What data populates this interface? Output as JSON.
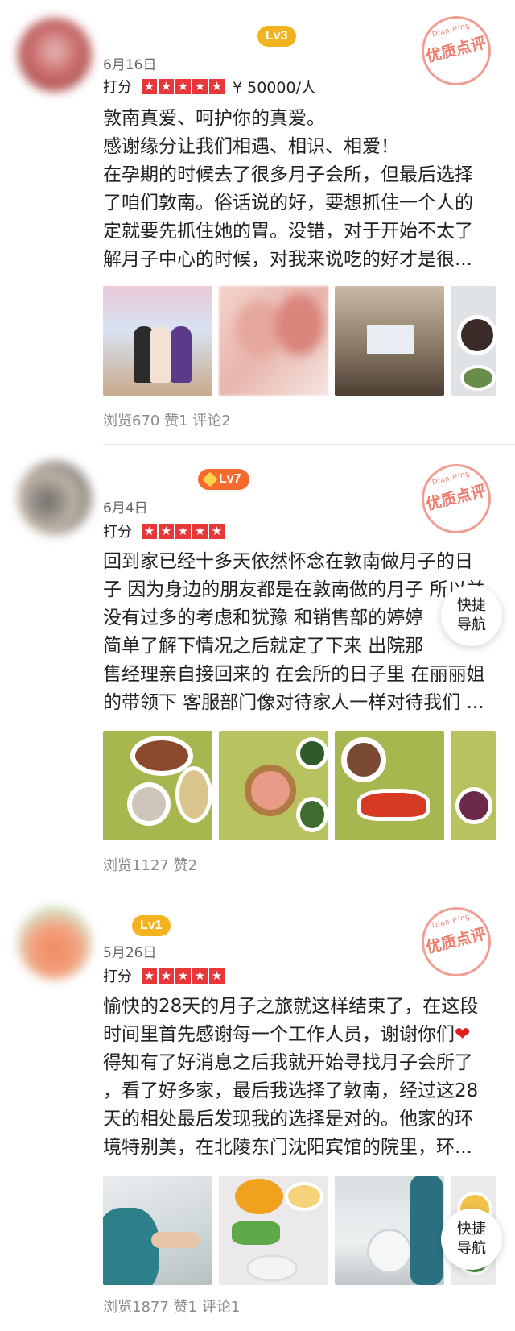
{
  "reviews": [
    {
      "level": "Lv3",
      "date": "6月16日",
      "score_label": "打分",
      "price": "¥ 50000/人",
      "stamp_en": "Dian Ping",
      "stamp_cn": "优质点评",
      "lines": [
        "敦南真爱、呵护你的真爱。",
        "感谢缘分让我们相遇、相识、相爱！",
        "在孕期的时候去了很多月子会所，但最后选择",
        "了咱们敦南。俗话说的好，要想抓住一个人的",
        "定就要先抓住她的胃。没错，对于开始不太了",
        "解月子中心的时候，对我来说吃的好才是很..."
      ],
      "stats": "浏览670  赞1  评论2",
      "rating": 5
    },
    {
      "level": "Lv7",
      "date": "6月4日",
      "score_label": "打分",
      "price": "",
      "stamp_en": "Dian Ping",
      "stamp_cn": "优质点评",
      "lines": [
        "回到家已经十多天依然怀念在敦南做月子的日",
        "子 因为身边的朋友都是在敦南做的月子 所以并",
        "没有过多的考虑和犹豫 和销售部的婷婷",
        "简单了解下情况之后就定了下来 出院那",
        "售经理亲自接回来的 在会所的日子里 在丽丽姐",
        "的带领下 客服部门像对待家人一样对待我们 ..."
      ],
      "stats": "浏览1127  赞2",
      "rating": 5
    },
    {
      "level": "Lv1",
      "date": "5月26日",
      "score_label": "打分",
      "price": "",
      "stamp_en": "Dian Ping",
      "stamp_cn": "优质点评",
      "lines": [
        "愉快的28天的月子之旅就这样结束了，在这段",
        "时间里首先感谢每一个工作人员，谢谢你们",
        "得知有了好消息之后我就开始寻找月子会所了",
        "，看了好多家，最后我选择了敦南，经过这28",
        "天的相处最后发现我的选择是对的。他家的环",
        "境特别美，在北陵东门沈阳宾馆的院里，环..."
      ],
      "heart": "❤",
      "stats": "浏览1877  赞1  评论1",
      "rating": 5
    }
  ],
  "quick_nav": {
    "line1": "快捷",
    "line2": "导航"
  },
  "colors": {
    "star_red": "#e8373a",
    "lv_gold": "#f3b21f",
    "lv_orange": "#f66a2e",
    "stamp_red": "#e6503c"
  }
}
